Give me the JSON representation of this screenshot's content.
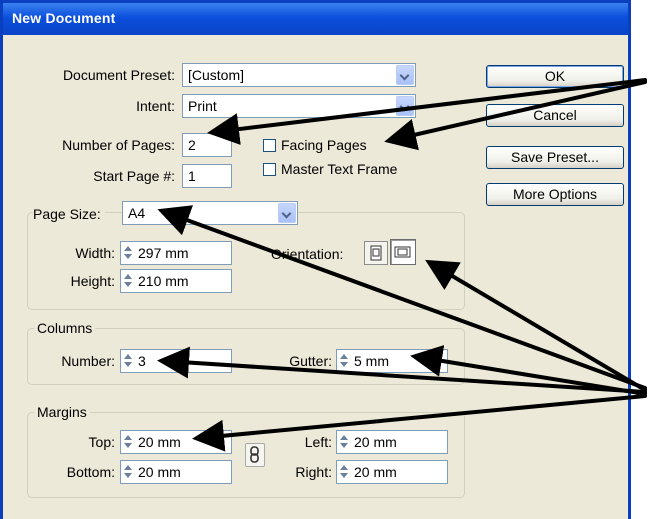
{
  "window": {
    "title": "New Document"
  },
  "preset": {
    "label": "Document Preset:",
    "value": "[Custom]"
  },
  "intent": {
    "label": "Intent:",
    "value": "Print"
  },
  "pages": {
    "number_label": "Number of Pages:",
    "number_value": "2",
    "start_label": "Start Page #:",
    "start_value": "1"
  },
  "options": {
    "facing_pages": {
      "label": "Facing Pages",
      "checked": false
    },
    "master_text_frame": {
      "label": "Master Text Frame",
      "checked": false
    }
  },
  "buttons": {
    "ok": "OK",
    "cancel": "Cancel",
    "save_preset": "Save Preset...",
    "more_options": "More Options"
  },
  "page_size": {
    "label": "Page Size:",
    "value": "A4",
    "width_label": "Width:",
    "width_value": "297 mm",
    "height_label": "Height:",
    "height_value": "210 mm",
    "orientation_label": "Orientation:",
    "orientation_selected": "landscape"
  },
  "columns": {
    "title": "Columns",
    "number_label": "Number:",
    "number_value": "3",
    "gutter_label": "Gutter:",
    "gutter_value": "5 mm"
  },
  "margins": {
    "title": "Margins",
    "top_label": "Top:",
    "top_value": "20 mm",
    "bottom_label": "Bottom:",
    "bottom_value": "20 mm",
    "left_label": "Left:",
    "left_value": "20 mm",
    "right_label": "Right:",
    "right_value": "20 mm"
  },
  "colors": {
    "titlebar": "#0b4fdc",
    "dialog_bg": "#ece9d8",
    "field_border": "#7f9db9",
    "annotation_arrow": "#000000"
  },
  "icons": [
    "chevron-down-icon",
    "spinner-arrows-icon",
    "portrait-icon",
    "landscape-icon",
    "chain-link-icon",
    "annotation-arrow-icon"
  ]
}
